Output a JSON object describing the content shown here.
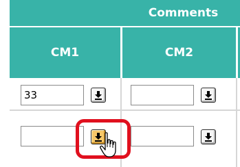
{
  "table": {
    "group_header": "Comments",
    "columns": [
      {
        "label": "CM1"
      },
      {
        "label": "CM2"
      }
    ],
    "rows": [
      {
        "cm1_value": "33",
        "cm2_value": ""
      },
      {
        "cm1_value": "",
        "cm2_value": ""
      }
    ]
  },
  "colors": {
    "header_bg": "#38b3a8",
    "header_text": "#ffffff",
    "highlight": "#e0101e",
    "active_button": "#f6c768"
  },
  "icons": {
    "dropdown": "download-arrow-icon",
    "cursor": "hand-pointer-cursor-icon"
  }
}
